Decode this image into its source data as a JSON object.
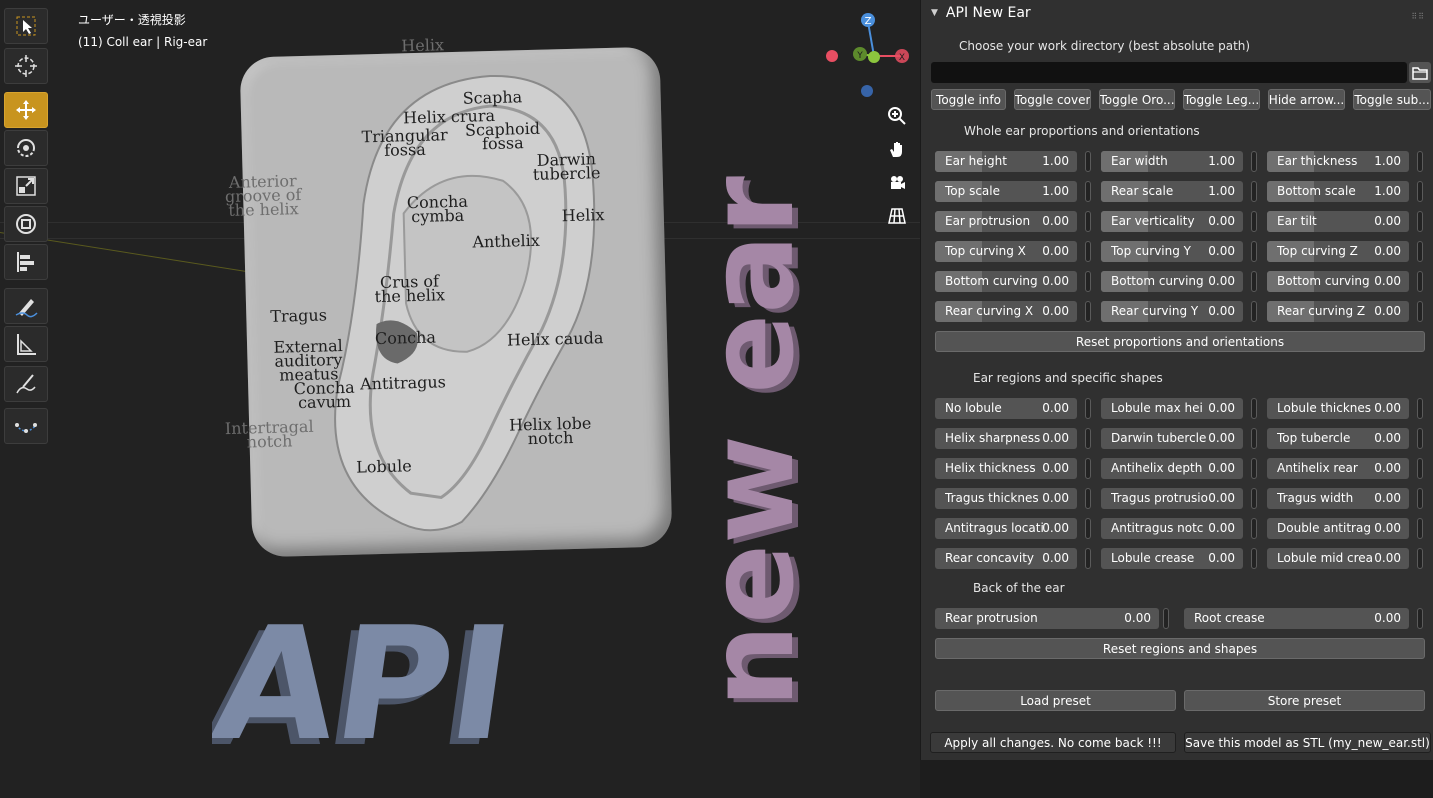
{
  "viewport": {
    "view_label": "ユーザー・透視投影",
    "object_label": "(11) Coll ear | Rig-ear",
    "gizmo": {
      "z": "Z",
      "y": "Y",
      "x": "X",
      "colors": {
        "x": "#e84e62",
        "y": "#8cc63e",
        "z": "#4a8fdc"
      }
    },
    "toolbar": [
      "cursor-select-icon",
      "3d-cursor-icon",
      "move-icon",
      "rotate-icon",
      "scale-icon",
      "transform-icon",
      "annotate-icon",
      "measure-icon",
      "draw-icon",
      "curve-icon"
    ],
    "nav": [
      "zoom-icon",
      "pan-hand-icon",
      "camera-icon",
      "ortho-grid-icon"
    ],
    "ear_labels": [
      "Helix",
      "Scapha",
      "Helix crura",
      "Triangular fossa",
      "Scaphoid fossa",
      "Darwin tubercle",
      "Anterior groove of the helix",
      "Concha cymba",
      "Helix",
      "Anthelix",
      "Crus of the helix",
      "Tragus",
      "Concha",
      "External auditory meatus",
      "Helix cauda",
      "Antitragus",
      "Concha cavum",
      "Intertragal notch",
      "Helix lobe notch",
      "Lobule"
    ],
    "title_3d_left": "API",
    "title_3d_right": "new ear",
    "colors": {
      "api": "#7c8aa6",
      "new_ear": "#a587a6",
      "card": "#b9b9b9"
    }
  },
  "panel": {
    "title": "API New Ear",
    "directory_prompt": "Choose your work directory (best absolute path)",
    "directory_value": "",
    "toggles": [
      "Toggle info",
      "Toggle cover",
      "Toggle Oro...",
      "Toggle Leg...",
      "Hide arrow...",
      "Toggle sub..."
    ],
    "section1": "Whole ear proportions and orientations",
    "proportions": [
      [
        {
          "label": "Ear height",
          "value": "1.00"
        },
        {
          "label": "Ear width",
          "value": "1.00"
        },
        {
          "label": "Ear thickness",
          "value": "1.00"
        }
      ],
      [
        {
          "label": "Top scale",
          "value": "1.00"
        },
        {
          "label": "Rear scale",
          "value": "1.00"
        },
        {
          "label": "Bottom scale",
          "value": "1.00"
        }
      ],
      [
        {
          "label": "Ear protrusion",
          "value": "0.00"
        },
        {
          "label": "Ear verticality",
          "value": "0.00"
        },
        {
          "label": "Ear tilt",
          "value": "0.00"
        }
      ],
      [
        {
          "label": "Top curving X",
          "value": "0.00"
        },
        {
          "label": "Top curving Y",
          "value": "0.00"
        },
        {
          "label": "Top curving Z",
          "value": "0.00"
        }
      ],
      [
        {
          "label": "Bottom curving",
          "value": "0.00"
        },
        {
          "label": "Bottom curving",
          "value": "0.00"
        },
        {
          "label": "Bottom curving",
          "value": "0.00"
        }
      ],
      [
        {
          "label": "Rear curving X",
          "value": "0.00"
        },
        {
          "label": "Rear curving Y",
          "value": "0.00"
        },
        {
          "label": "Rear curving Z",
          "value": "0.00"
        }
      ]
    ],
    "reset1": "Reset proportions and orientations",
    "section2": "Ear regions and specific shapes",
    "regions": [
      [
        {
          "label": "No lobule",
          "value": "0.00"
        },
        {
          "label": "Lobule max hei",
          "value": "0.00"
        },
        {
          "label": "Lobule thicknes",
          "value": "0.00"
        }
      ],
      [
        {
          "label": "Helix sharpness",
          "value": "0.00"
        },
        {
          "label": "Darwin tubercle",
          "value": "0.00"
        },
        {
          "label": "Top tubercle",
          "value": "0.00"
        }
      ],
      [
        {
          "label": "Helix thickness",
          "value": "0.00"
        },
        {
          "label": "Antihelix depth",
          "value": "0.00"
        },
        {
          "label": "Antihelix rear",
          "value": "0.00"
        }
      ],
      [
        {
          "label": "Tragus thicknes",
          "value": "0.00"
        },
        {
          "label": "Tragus protrusio",
          "value": "0.00"
        },
        {
          "label": "Tragus width",
          "value": "0.00"
        }
      ],
      [
        {
          "label": "Antitragus locati",
          "value": "0.00"
        },
        {
          "label": "Antitragus notc",
          "value": "0.00"
        },
        {
          "label": "Double antitrag",
          "value": "0.00"
        }
      ],
      [
        {
          "label": "Rear concavity",
          "value": "0.00"
        },
        {
          "label": "Lobule crease",
          "value": "0.00"
        },
        {
          "label": "Lobule mid crea",
          "value": "0.00"
        }
      ]
    ],
    "section3": "Back of the ear",
    "back": [
      {
        "label": "Rear protrusion",
        "value": "0.00"
      },
      {
        "label": "Root crease",
        "value": "0.00"
      }
    ],
    "reset2": "Reset regions and shapes",
    "load_preset": "Load preset",
    "store_preset": "Store preset",
    "apply": "Apply all changes. No come back !!!",
    "save_stl": "Save this model as STL (my_new_ear.stl)"
  }
}
